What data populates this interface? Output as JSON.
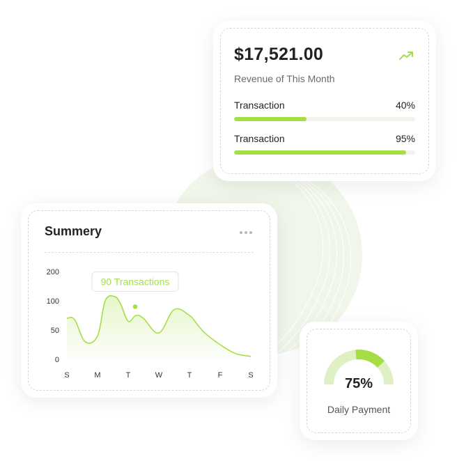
{
  "revenue": {
    "amount": "$17,521.00",
    "subtitle": "Revenue of This Month",
    "trend_icon": "trending-up-icon",
    "transactions": [
      {
        "label": "Transaction",
        "percent_text": "40%",
        "value": 40
      },
      {
        "label": "Transaction",
        "percent_text": "95%",
        "value": 95
      }
    ]
  },
  "summary": {
    "title": "Summery",
    "menu_icon": "more-icon"
  },
  "chart_data": {
    "type": "area",
    "categories": [
      "S",
      "M",
      "T",
      "W",
      "T",
      "F",
      "S"
    ],
    "y_ticks": [
      "200",
      "100",
      "50",
      "0"
    ],
    "x": [
      0,
      0.25,
      0.6,
      1.0,
      1.25,
      1.55,
      1.75,
      2.0,
      2.25,
      2.5,
      3.0,
      3.5,
      4.0,
      4.25,
      4.5,
      5.0,
      5.5,
      6.0
    ],
    "values": [
      70,
      68,
      30,
      40,
      100,
      115,
      95,
      65,
      75,
      70,
      45,
      85,
      75,
      60,
      45,
      25,
      10,
      5
    ],
    "tooltip": {
      "label": "90 Transactions",
      "category": "T",
      "value": 90
    },
    "grid": false,
    "legend": "none"
  },
  "payment": {
    "percent_text": "75%",
    "value": 75,
    "label": "Daily Payment"
  },
  "colors": {
    "accent": "#a6de47",
    "accent_light": "#dff1c4",
    "text": "#222222",
    "muted": "#6a6a6a"
  }
}
